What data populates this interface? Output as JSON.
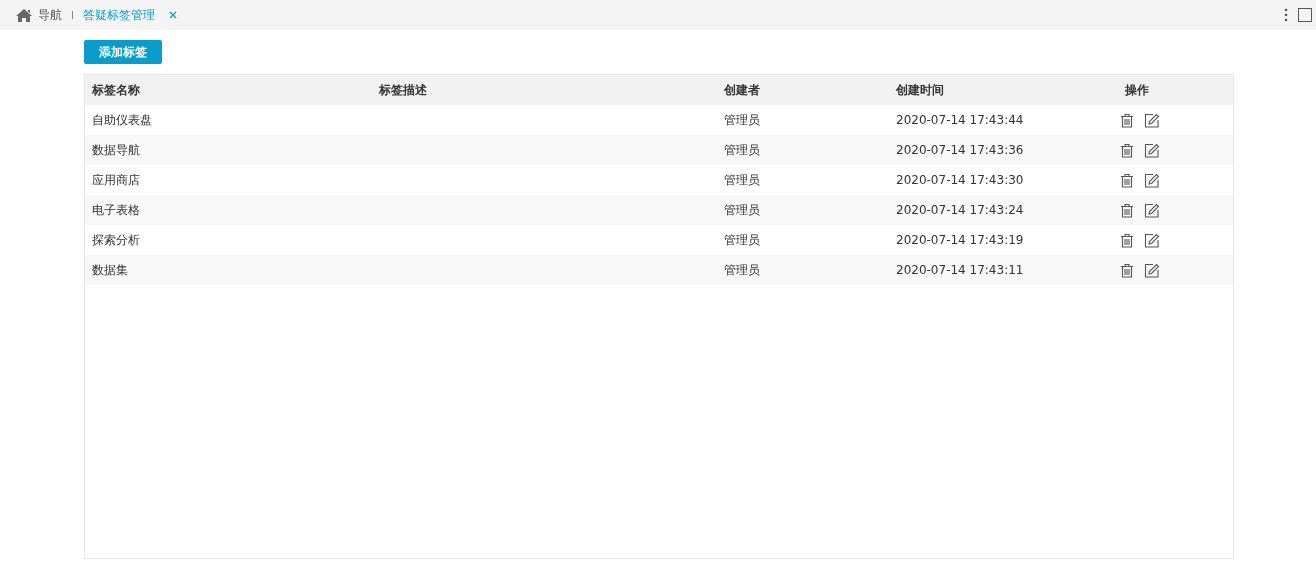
{
  "tabs": [
    {
      "label": "导航",
      "kind": "home",
      "selected": false
    },
    {
      "label": "答疑标签管理",
      "kind": "page",
      "selected": true,
      "closable": true
    }
  ],
  "add_button": "添加标签",
  "table": {
    "columns": [
      "标签名称",
      "标签描述",
      "创建者",
      "创建时间",
      "操作"
    ],
    "rows": [
      {
        "name": "自助仪表盘",
        "creator": "管理员",
        "time": "2020-07-14 17:43:44"
      },
      {
        "name": "数据导航",
        "creator": "管理员",
        "time": "2020-07-14 17:43:36"
      },
      {
        "name": "应用商店",
        "creator": "管理员",
        "time": "2020-07-14 17:43:30"
      },
      {
        "name": "电子表格",
        "creator": "管理员",
        "time": "2020-07-14 17:43:24"
      },
      {
        "name": "探索分析",
        "creator": "管理员",
        "time": "2020-07-14 17:43:19"
      },
      {
        "name": "数据集",
        "creator": "管理员",
        "time": "2020-07-14 17:43:11"
      }
    ]
  }
}
